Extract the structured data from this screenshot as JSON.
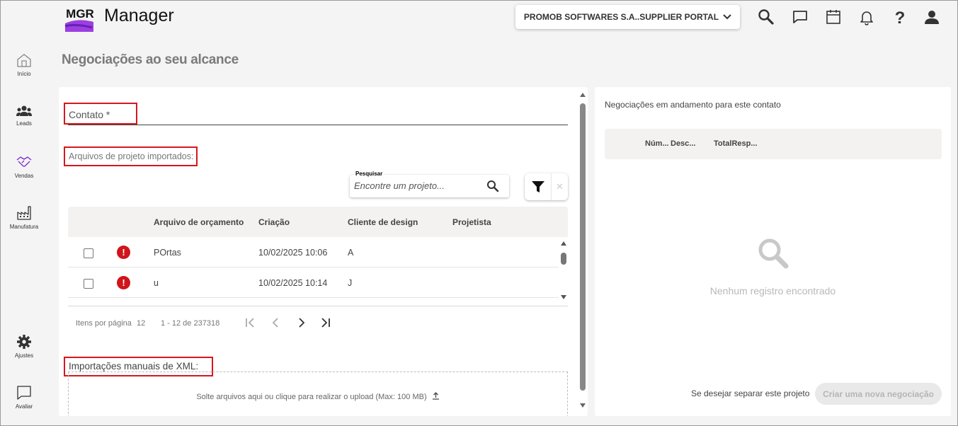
{
  "app": {
    "logo_text": "MGR",
    "title": "Manager"
  },
  "header": {
    "supplier_selector": "PROMOB SOFTWARES S.A..SUPPLIER PORTAL",
    "icons": [
      "search-icon",
      "chat-icon",
      "calendar-icon",
      "bell-icon",
      "help-icon",
      "user-icon"
    ]
  },
  "sidebar": {
    "items": [
      {
        "label": "Início",
        "icon": "home-icon"
      },
      {
        "label": "Leads",
        "icon": "people-icon"
      },
      {
        "label": "Vendas",
        "icon": "handshake-icon",
        "active": true
      },
      {
        "label": "Manufatura",
        "icon": "factory-icon"
      },
      {
        "label": "Ajustes",
        "icon": "gear-icon"
      },
      {
        "label": "Avaliar",
        "icon": "feedback-icon"
      }
    ]
  },
  "page": {
    "title": "Negociações ao seu alcance"
  },
  "form": {
    "contato_label": "Contato *",
    "arquivos_label": "Arquivos de projeto importados:",
    "search": {
      "caption": "Pesquisar",
      "placeholder": "Encontre um projeto..."
    },
    "table": {
      "columns": [
        "Arquivo de orçamento",
        "Criação",
        "Cliente de design",
        "Projetista"
      ],
      "rows": [
        {
          "arquivo": "POrtas",
          "criacao": "10/02/2025 10:06",
          "cliente": "A",
          "projetista": ""
        },
        {
          "arquivo": "u",
          "criacao": "10/02/2025 10:14",
          "cliente": "J",
          "projetista": ""
        }
      ]
    },
    "paginator": {
      "items_per_page_label": "Itens por página",
      "items_per_page": "12",
      "range": "1 - 12 de 237318"
    },
    "xml_label": "Importações manuais de XML:",
    "upload_text": "Solte arquivos aqui ou clique para realizar o upload (Max: 100 MB)"
  },
  "right_panel": {
    "title": "Negociações em andamento para este contato",
    "columns": [
      "Núm...",
      "Desc...",
      "TotalResp..."
    ],
    "empty_text": "Nenhum registro encontrado",
    "separate_text": "Se desejar separar este projeto",
    "new_button": "Criar uma nova negociação"
  },
  "colors": {
    "accent": "#7b2fd1",
    "highlight": "#d8161d",
    "error": "#d0141b"
  }
}
